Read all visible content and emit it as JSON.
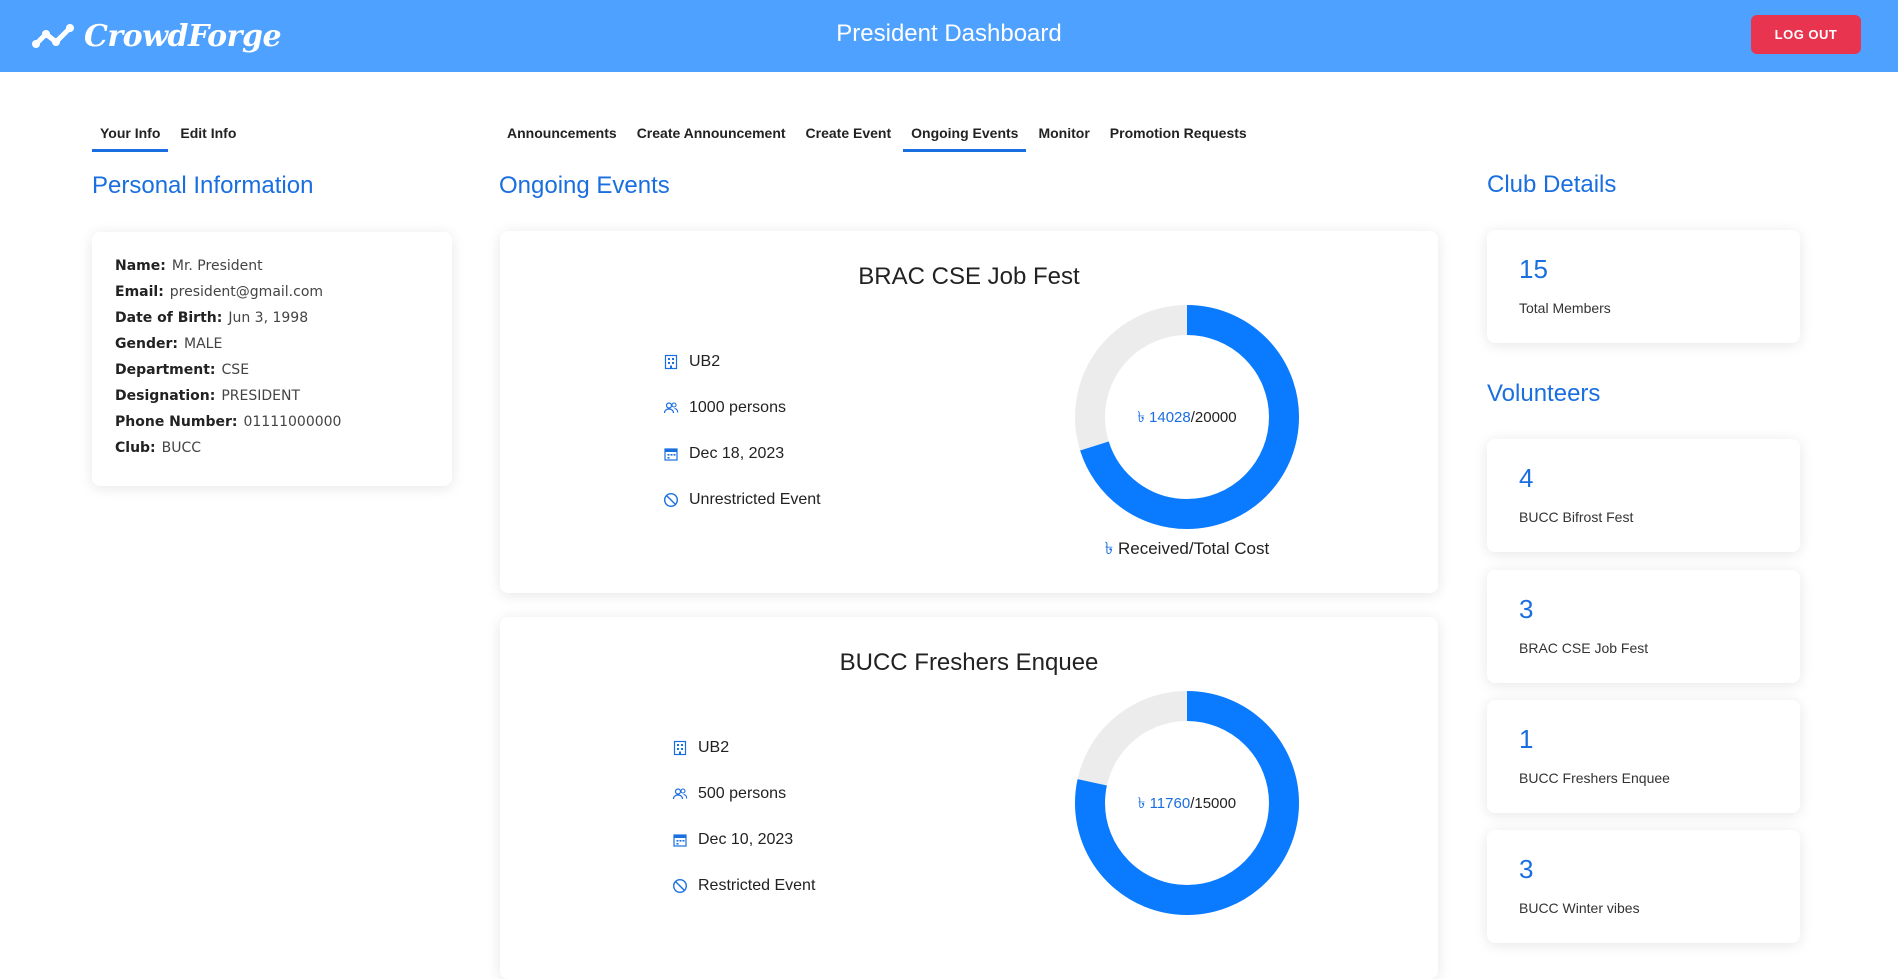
{
  "header": {
    "logo_text": "CrowdForge",
    "title": "President Dashboard",
    "logout_label": "LOG OUT"
  },
  "left_tabs": [
    {
      "label": "Your Info",
      "active": true
    },
    {
      "label": "Edit Info",
      "active": false
    }
  ],
  "main_tabs": [
    {
      "label": "Announcements",
      "active": false
    },
    {
      "label": "Create Announcement",
      "active": false
    },
    {
      "label": "Create Event",
      "active": false
    },
    {
      "label": "Ongoing Events",
      "active": true
    },
    {
      "label": "Monitor",
      "active": false
    },
    {
      "label": "Promotion Requests",
      "active": false
    }
  ],
  "personal": {
    "heading": "Personal Information",
    "fields": [
      {
        "key": "Name:",
        "value": "Mr. President"
      },
      {
        "key": "Email:",
        "value": "president@gmail.com"
      },
      {
        "key": "Date of Birth:",
        "value": "Jun 3, 1998"
      },
      {
        "key": "Gender:",
        "value": "MALE"
      },
      {
        "key": "Department:",
        "value": "CSE"
      },
      {
        "key": "Designation:",
        "value": "PRESIDENT"
      },
      {
        "key": "Phone Number:",
        "value": "01111000000"
      },
      {
        "key": "Club:",
        "value": "BUCC"
      }
    ]
  },
  "ongoing": {
    "heading": "Ongoing Events",
    "currency_symbol": "৳",
    "events": [
      {
        "title": "BRAC CSE Job Fest",
        "venue": "UB2",
        "capacity": "1000 persons",
        "date": "Dec 18, 2023",
        "restriction": "Unrestricted Event",
        "received": "14028",
        "total": "/20000",
        "received_fraction": 0.7014,
        "caption": "Received/Total Cost"
      },
      {
        "title": "BUCC Freshers Enquee",
        "venue": "UB2",
        "capacity": "500 persons",
        "date": "Dec 10, 2023",
        "restriction": "Restricted Event",
        "received": "11760",
        "total": "/15000",
        "received_fraction": 0.784,
        "caption": "Received/Total Cost"
      }
    ]
  },
  "club": {
    "heading": "Club Details",
    "total_members": {
      "value": "15",
      "label": "Total Members"
    }
  },
  "volunteers": {
    "heading": "Volunteers",
    "items": [
      {
        "value": "4",
        "label": "BUCC Bifrost Fest"
      },
      {
        "value": "3",
        "label": "BRAC CSE Job Fest"
      },
      {
        "value": "1",
        "label": "BUCC Freshers Enquee"
      },
      {
        "value": "3",
        "label": "BUCC Winter vibes"
      }
    ]
  },
  "colors": {
    "header_bg": "#4fa1ff",
    "accent": "#1a6fe0",
    "donut_fill": "#0a7bff",
    "donut_track": "#ececec",
    "logout_bg": "#e8344e"
  }
}
